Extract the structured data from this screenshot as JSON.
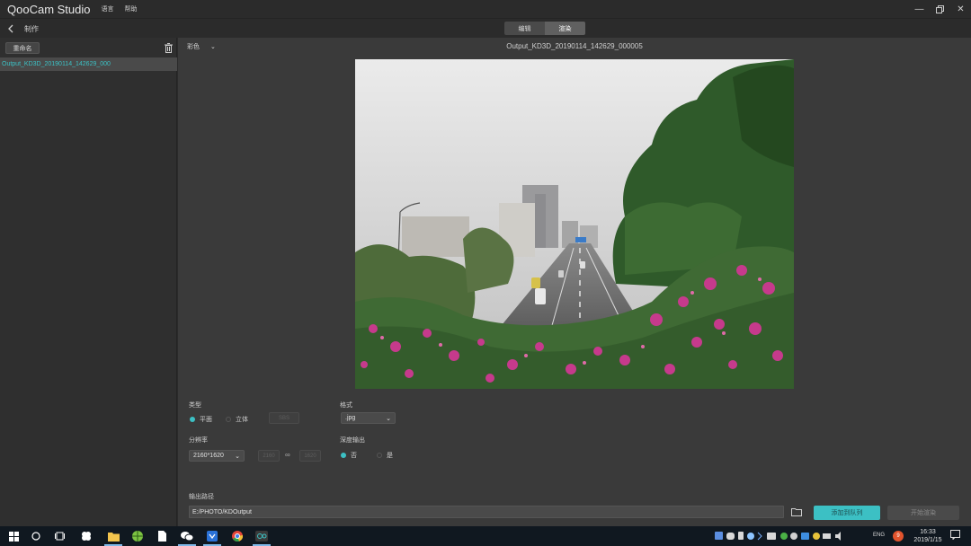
{
  "app": {
    "title": "QooCam Studio",
    "menu": [
      "语言",
      "帮助"
    ]
  },
  "toolbar": {
    "section_title": "制作",
    "tabs": [
      {
        "label": "编辑",
        "active": false
      },
      {
        "label": "渲染",
        "active": true
      }
    ]
  },
  "sidebar": {
    "rename_label": "重命名",
    "selected_file": "Output_KD3D_20190114_142629_000"
  },
  "preview": {
    "color_mode": "彩色",
    "filename": "Output_KD3D_20190114_142629_000005"
  },
  "settings": {
    "type_label": "类型",
    "type_options": [
      {
        "label": "平面",
        "selected": true
      },
      {
        "label": "立体",
        "selected": false
      }
    ],
    "type_mode_placeholder": "SBS",
    "format_label": "格式",
    "format_value": ".jpg",
    "resolution_label": "分辨率",
    "resolution_value": "2160*1620",
    "width_placeholder": "2160",
    "height_placeholder": "1620",
    "depth_label": "深度输出",
    "depth_options": [
      {
        "label": "否",
        "selected": true
      },
      {
        "label": "是",
        "selected": false
      }
    ],
    "output_path_label": "输出路径",
    "output_path_value": "E:/PHOTO/KDOutput",
    "add_queue_label": "添加到队列",
    "start_render_label": "开始渲染"
  },
  "taskbar": {
    "language": "ENG",
    "time": "16:33",
    "date": "2019/1/15",
    "notification_count": "9"
  },
  "colors": {
    "accent": "#3cc0c4",
    "background": "#3a3a3a",
    "panel": "#2f2f2f"
  }
}
